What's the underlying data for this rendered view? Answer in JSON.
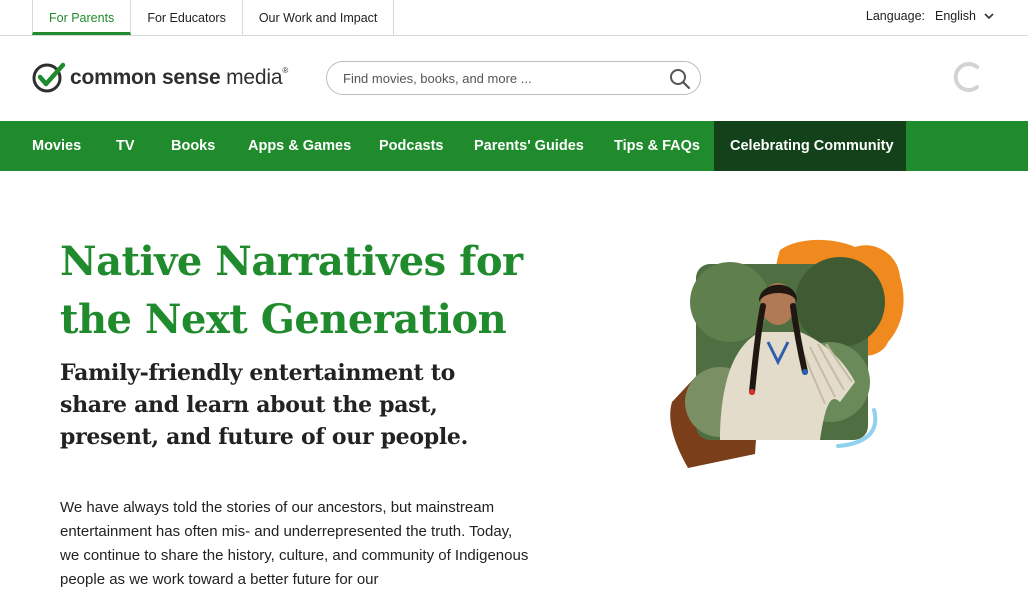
{
  "audience_tabs": [
    {
      "label": "For Parents",
      "active": true
    },
    {
      "label": "For Educators",
      "active": false
    },
    {
      "label": "Our Work and Impact",
      "active": false
    }
  ],
  "language": {
    "label": "Language:",
    "value": "English"
  },
  "logo": {
    "text_bold": "common sense",
    "text_light": " media",
    "mark": "®"
  },
  "search": {
    "placeholder": "Find movies, books, and more ...",
    "value": ""
  },
  "nav": [
    {
      "label": "Movies"
    },
    {
      "label": "TV"
    },
    {
      "label": "Books"
    },
    {
      "label": "Apps & Games"
    },
    {
      "label": "Podcasts"
    },
    {
      "label": "Parents' Guides"
    },
    {
      "label": "Tips & FAQs"
    },
    {
      "label": "Celebrating Community",
      "highlighted": true
    }
  ],
  "hero": {
    "title": "Native Narratives for the Next Generation",
    "subtitle": "Family-friendly entertainment to share and learn about the past, present, and future of our people.",
    "body": "We have always told the stories of our ancestors, but mainstream entertainment has often mis- and underrepresented the truth. Today, we continue to share the history, culture, and community of Indigenous people as we work toward a better future for our"
  },
  "colors": {
    "brand_green": "#1f8b2c",
    "nav_highlight": "#13421a",
    "art_orange": "#f08a1e",
    "art_brown": "#7a3f1a",
    "art_light_blue": "#8fd1ee"
  },
  "icons": {
    "search": "search-icon",
    "chevron": "chevron-down-icon",
    "spinner": "loading-spinner-icon",
    "logo": "checkmark-logo-icon"
  }
}
